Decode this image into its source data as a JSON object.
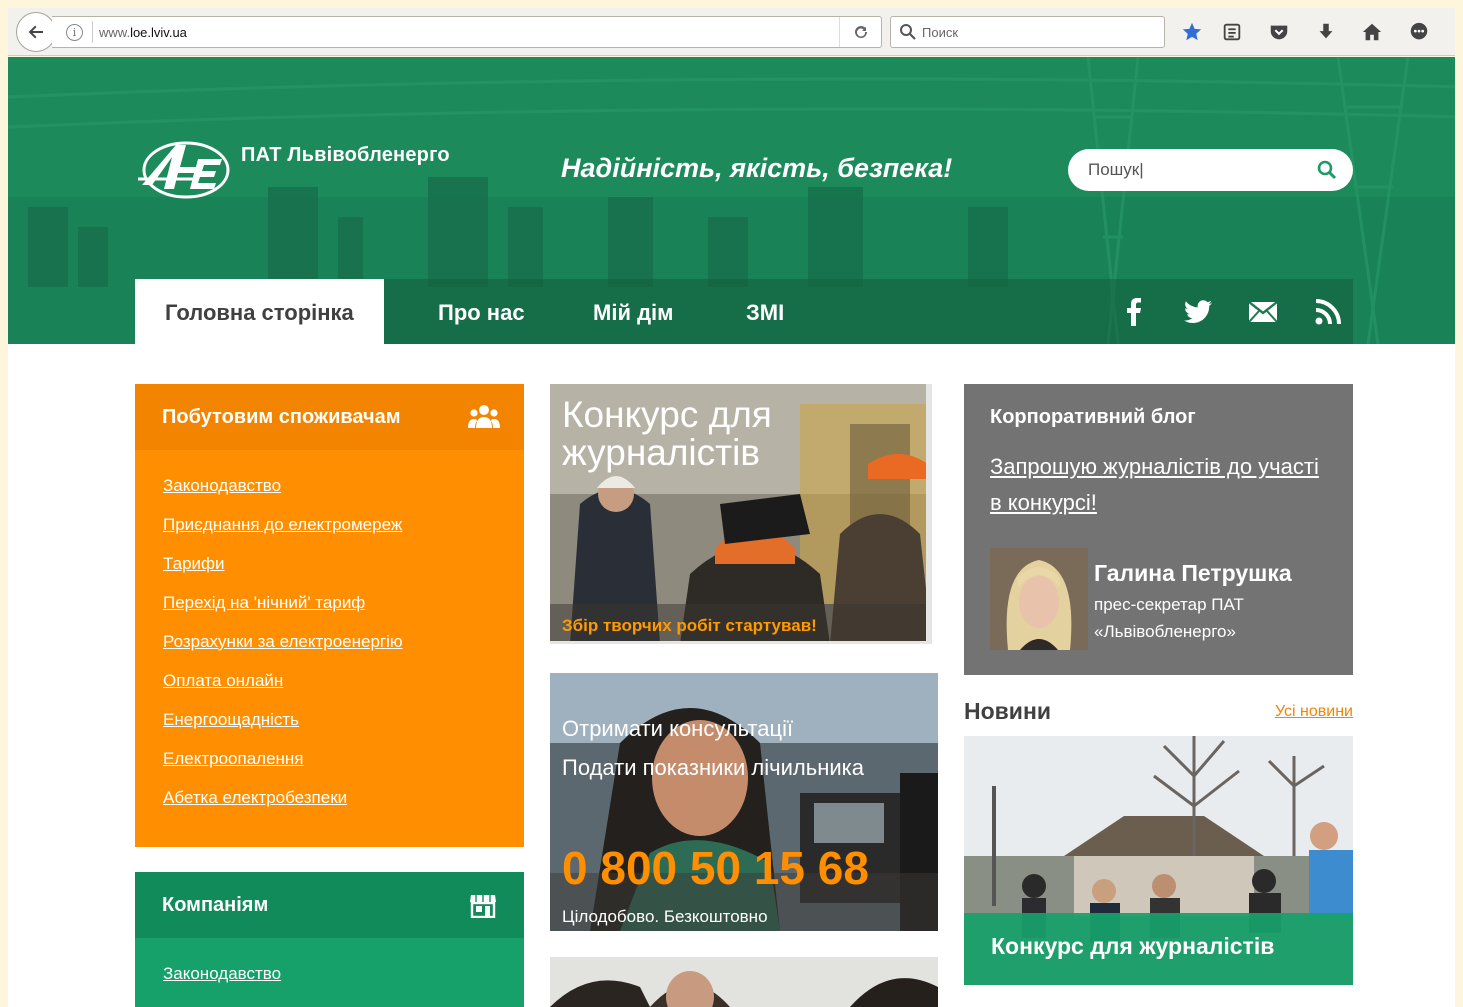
{
  "browser": {
    "url_prefix": "www.",
    "url_host": "loe.lviv.ua",
    "search_placeholder": "Поиск"
  },
  "header": {
    "company_name": "ПАТ Львівобленерго",
    "slogan": "Надійність, якість, безпека!",
    "search_placeholder": "Пошук|"
  },
  "nav": {
    "items": [
      {
        "label": "Головна сторінка",
        "active": true
      },
      {
        "label": "Про нас"
      },
      {
        "label": "Мій дім"
      },
      {
        "label": "ЗМІ"
      }
    ],
    "social": [
      "facebook-icon",
      "twitter-icon",
      "mail-icon",
      "rss-icon"
    ]
  },
  "consumers": {
    "title": "Побутовим споживачам",
    "icon": "users-icon",
    "links": [
      "Законодавство",
      "Приєднання до електромереж",
      "Тарифи",
      "Перехід на 'нічний' тариф",
      "Розрахунки за електроенергію",
      "Оплата онлайн",
      "Енергоощадність",
      "Електроопалення",
      "Абетка електробезпеки"
    ]
  },
  "companies": {
    "title": "Компаніям",
    "icon": "store-icon",
    "links": [
      "Законодавство"
    ]
  },
  "promo1": {
    "title_line1": "Конкурс для",
    "title_line2": "журналістів",
    "caption": "Збір творчих робіт стартував!"
  },
  "promo2": {
    "line1": "Отримати консультації",
    "line2": "Подати показники лічильника",
    "phone": "0 800 50 15 68",
    "note": "Цілодобово. Безкоштовно"
  },
  "blog": {
    "title": "Корпоративний блог",
    "post": "Запрошую журналістів до участі в конкурсі!",
    "author_name": "Галина Петрушка",
    "author_role_line1": "прес-секретар ПАТ",
    "author_role_line2": "«Львівобленерго»"
  },
  "news": {
    "title": "Новини",
    "all_link": "Усі новини",
    "card_caption": "Конкурс для журналістів"
  },
  "colors": {
    "brand_green": "#1d8a5c",
    "orange": "#ff8f00",
    "green_panel": "#16a06a",
    "blog_gray": "#737373"
  }
}
